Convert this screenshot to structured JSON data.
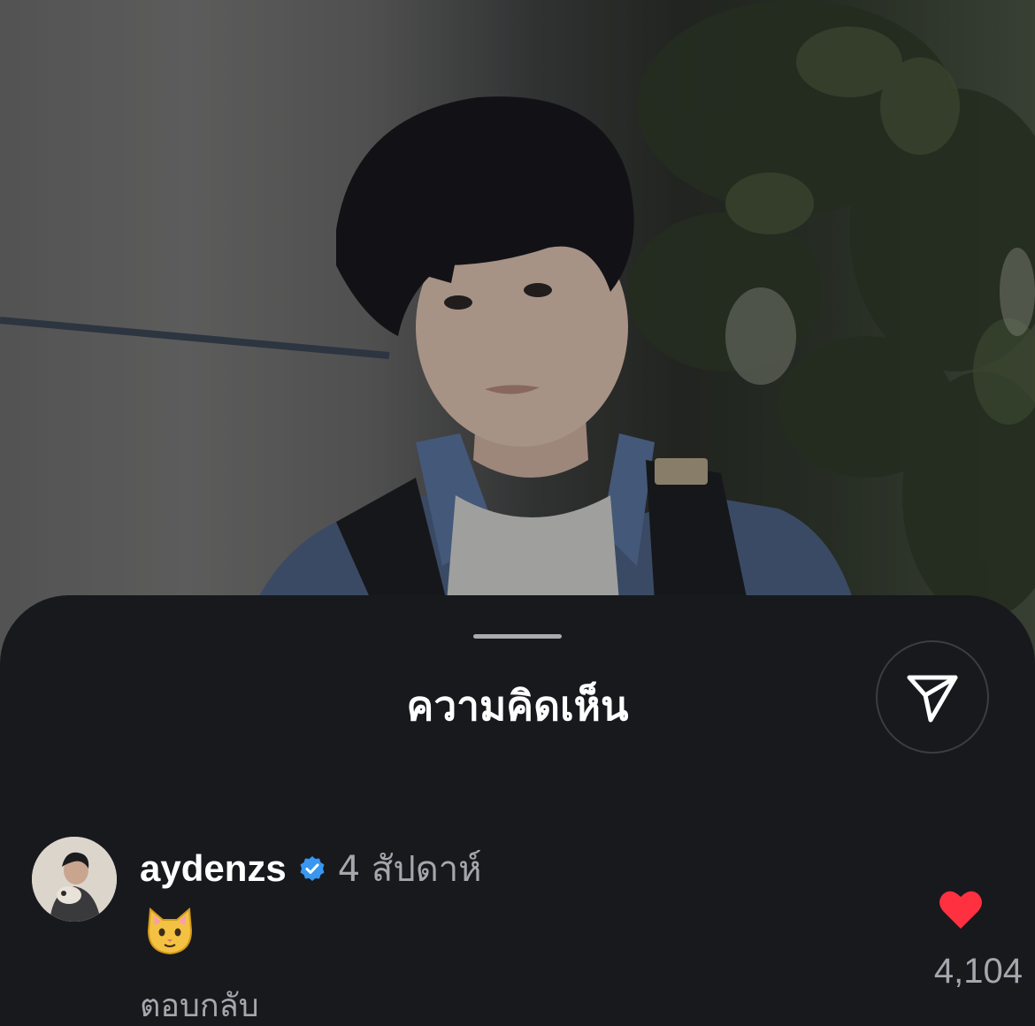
{
  "sheet": {
    "title": "ความคิดเห็น"
  },
  "share_button": {
    "icon": "paper-plane-icon"
  },
  "comment": {
    "username": "aydenzs",
    "verified_icon": "verified-badge-icon",
    "time": "4 สัปดาห์",
    "body_icon": "cat-face-emoji",
    "reply_label": "ตอบกลับ",
    "like_icon": "heart-icon",
    "like_count": "4,104",
    "like_color": "#ff3040"
  },
  "colors": {
    "sheet_background": "#17191d",
    "text_primary": "#ffffff",
    "text_secondary": "#a4a7ad",
    "verified": "#3897f0"
  }
}
